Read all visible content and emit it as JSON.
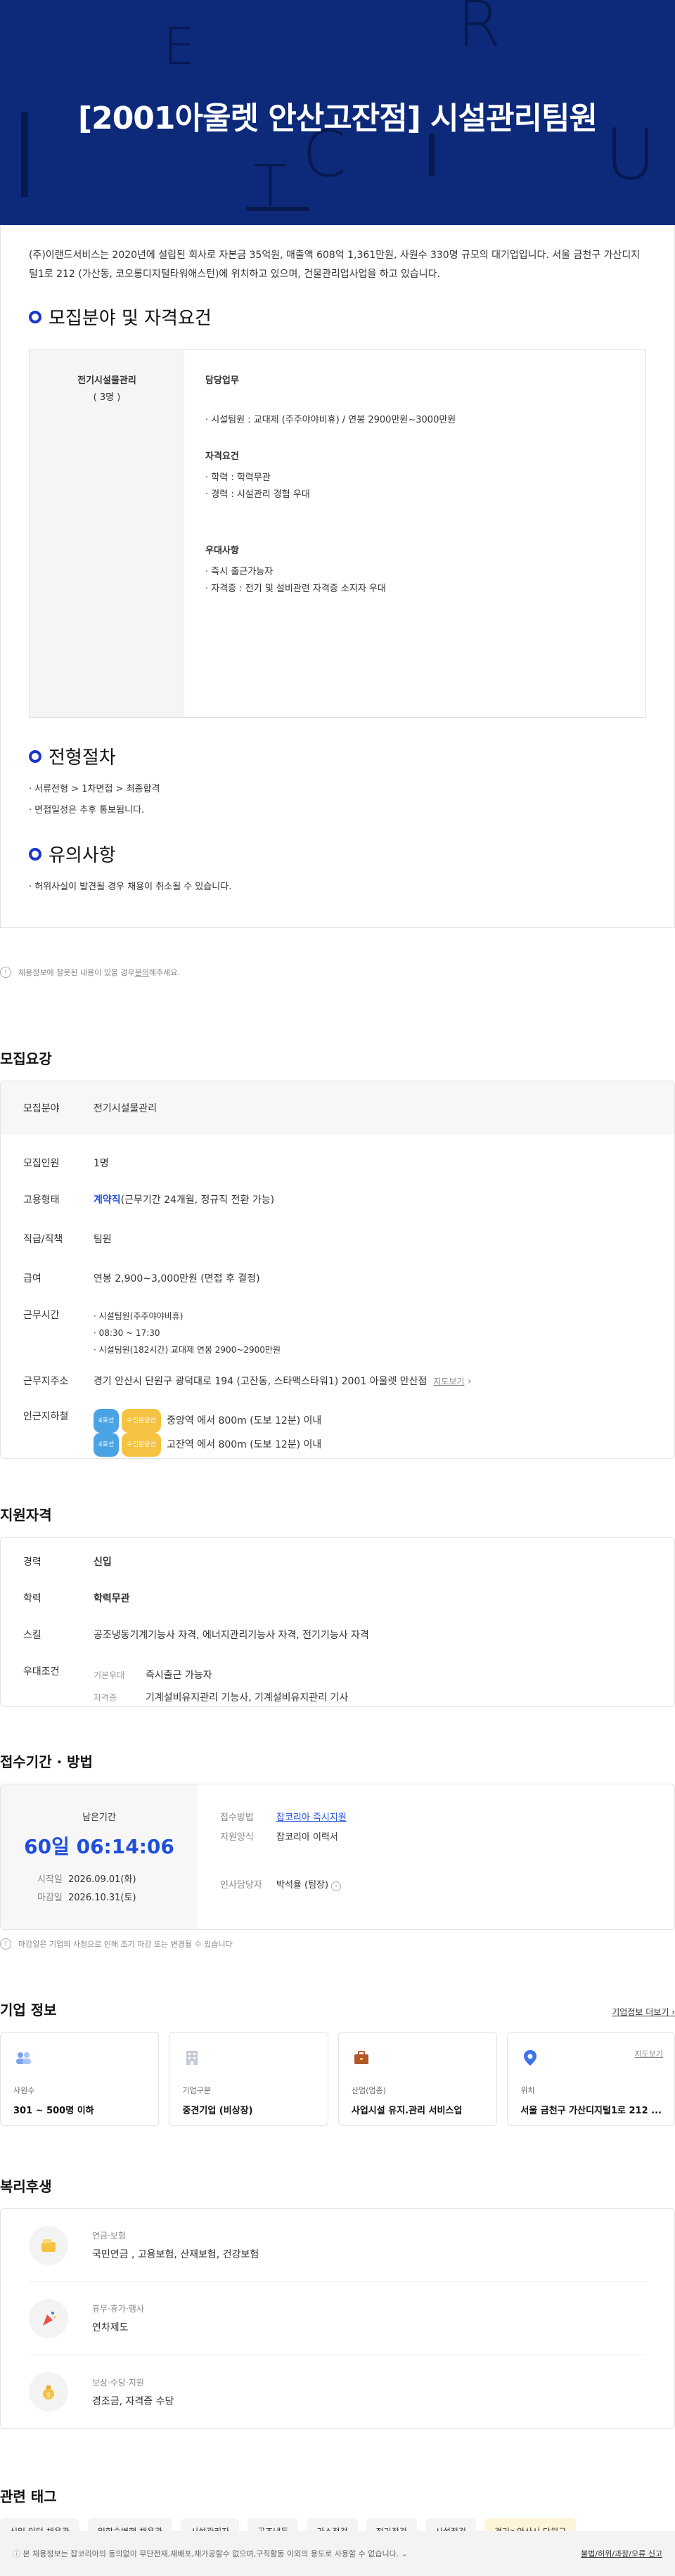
{
  "hero": {
    "title": "[2001아울렛 안산고잔점] 시설관리팀원"
  },
  "intro": "(주)이랜드서비스는 2020년에 설립된 회사로 자본금 35억원, 매출액 608억 1,361만원, 사원수 330명 규모의 대기업입니다. 서울 금천구 가산디지털1로 212 (가산동, 코오롱디지털타워애스턴)에 위치하고 있으며, 건물관리업사업을 하고 있습니다.",
  "section_recruit": {
    "title": "모집분야 및 자격요건",
    "field": "전기시설물관리",
    "count": "( 3명 )",
    "duty_head": "담당업무",
    "duty_items": [
      "시설팀원 : 교대제 (주주야야비휴) / 연봉 2900만원~3000만원"
    ],
    "qual_head": "자격요건",
    "qual_items": [
      "학력 : 학력무관",
      "경력 : 시설관리 경험 우대"
    ],
    "pref_head": "우대사항",
    "pref_items": [
      "즉시 출근가능자",
      "자격증 : 전기 및 설비관련 자격증 소지자 우대"
    ]
  },
  "section_process": {
    "title": "전형절차",
    "items": [
      "서류전형 > 1차면접 > 최종합격",
      "면접일정은 추후 통보됩니다."
    ]
  },
  "section_notice": {
    "title": "유의사항",
    "items": [
      "허위사실이 발견될 경우 채용이 취소될 수 있습니다."
    ]
  },
  "report": {
    "prefix": "채용정보에 잘못된 내용이 있을 경우 ",
    "link": "문의",
    "suffix": "해주세요."
  },
  "summary": {
    "title": "모집요강",
    "field_k": "모집분야",
    "field_v": "전기시설물관리",
    "count_k": "모집인원",
    "count_v": "1명",
    "type_k": "고용형태",
    "type_v": "계약직",
    "type_extra": "(근무기간 24개월, 정규직 전환 가능)",
    "rank_k": "직급/직책",
    "rank_v": "팀원",
    "pay_k": "급여",
    "pay_v": "연봉 2,900~3,000만원 (면접 후 결정)",
    "hours_k": "근무시간",
    "hours_items": [
      "시설팀원(주주야야비휴)",
      "08:30 ~ 17:30",
      "시설팀원(182시간) 교대제 연봉 2900~2900만원"
    ],
    "place_k": "근무지주소",
    "place_v": "경기 안산시 단원구 광덕대로 194 (고잔동, 스타맥스타워1) 2001 아울렛 안산점",
    "map_link": "지도보기",
    "subway_k": "인근지하철",
    "subway": [
      {
        "chip1": "4호선",
        "chip2": "수인분당선",
        "text": "중앙역 에서 800m (도보 12분) 이내"
      },
      {
        "chip1": "4호선",
        "chip2": "수인분당선",
        "text": "고잔역 에서 800m (도보 12분) 이내"
      }
    ]
  },
  "qualification": {
    "title": "지원자격",
    "career_k": "경력",
    "career_v": "신입",
    "edu_k": "학력",
    "edu_v": "학력무관",
    "skill_k": "스킬",
    "skill_v": "공조냉동기계기능사 자격, 에너지관리기능사 자격, 전기기능사 자격",
    "pref_k": "우대조건",
    "pref1_k": "기본우대",
    "pref1_v": "즉시출근 가능자",
    "pref2_k": "자격증",
    "pref2_v": "기계설비유지관리 기능사, 기계설비유지관리 기사"
  },
  "period": {
    "title": "접수기간 · 방법",
    "remain_label": "남은기간",
    "remain_time": "60일 06:14:06",
    "start_k": "시작일",
    "start_v": "2026.09.01(화)",
    "end_k": "마감일",
    "end_v": "2026.10.31(토)",
    "method_k": "접수방법",
    "method_v": "잡코리아 즉시지원",
    "form_k": "지원양식",
    "form_v": "잡코리아 이력서",
    "hr_k": "인사담당자",
    "hr_v": "박석율 (팀장)",
    "note": "마감일은 기업의 사정으로 인해 조기 마감 또는 변경될 수 있습니다"
  },
  "company": {
    "title": "기업 정보",
    "more": "기업정보 더보기",
    "cards": [
      {
        "k": "사원수",
        "v": "301 ~ 500명 이하",
        "icon": "people-icon"
      },
      {
        "k": "기업구분",
        "v": "중견기업 (비상장)",
        "icon": "building-icon"
      },
      {
        "k": "산업(업종)",
        "v": "사업시설 유지.관리 서비스업",
        "icon": "briefcase-icon"
      },
      {
        "k": "위치",
        "v": "서울 금천구 가산디지털1로 212 ...",
        "icon": "pin-icon",
        "link": "지도보기"
      }
    ]
  },
  "welfare": {
    "title": "복리후생",
    "items": [
      {
        "k": "연금·보험",
        "v": "국민연금 , 고용보험, 산재보험, 건강보험"
      },
      {
        "k": "휴무·휴가·행사",
        "v": "연차제도"
      },
      {
        "k": "보상·수당·지원",
        "v": "경조금, 자격증 수당"
      }
    ]
  },
  "tags": {
    "title": "관련 태그",
    "items": [
      "신입·인턴 채용관",
      "일학습병행 채용관",
      "시설관리자",
      "공조냉동",
      "가스점검",
      "전기점검",
      "시설점검",
      "경기>안산시 단원구"
    ]
  },
  "footer": {
    "left": "본 채용정보는 잡코리아의 동의없이 무단전재,재배포,재가공할수 없으며,구직활동 이외의 용도로 사용할 수 없습니다.",
    "right": "불법/허위/과장/오류 신고"
  }
}
